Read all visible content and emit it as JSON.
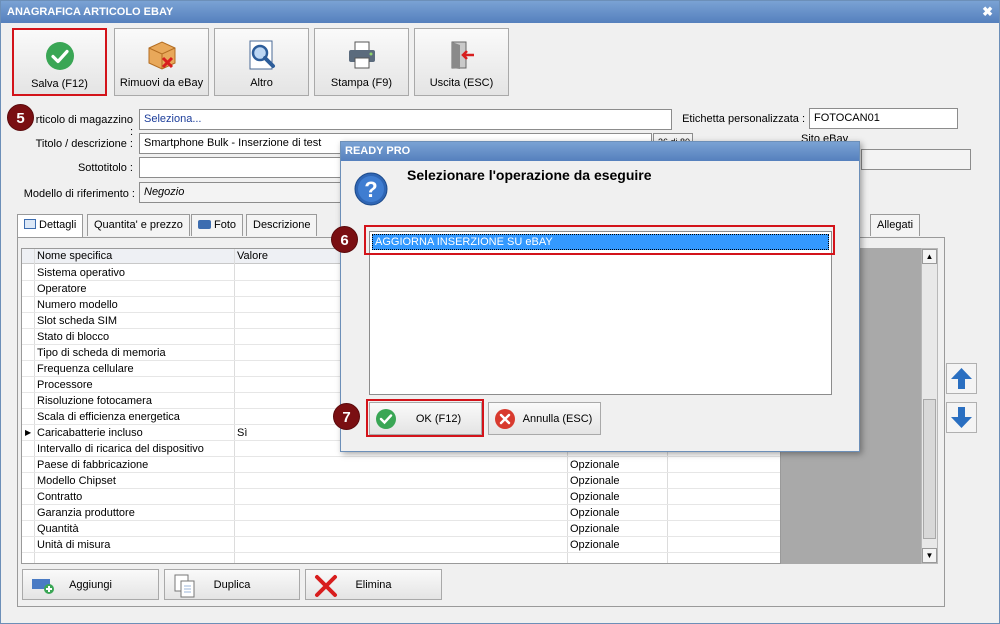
{
  "window": {
    "title": "ANAGRAFICA ARTICOLO EBAY",
    "close_glyph": "✖"
  },
  "toolbar": [
    {
      "label": "Salva (F12)",
      "icon": "check-circle-icon"
    },
    {
      "label": "Rimuovi da eBay",
      "icon": "box-remove-icon"
    },
    {
      "label": "Altro",
      "icon": "magnify-icon"
    },
    {
      "label": "Stampa (F9)",
      "icon": "printer-icon"
    },
    {
      "label": "Uscita (ESC)",
      "icon": "exit-door-icon"
    }
  ],
  "form": {
    "articolo_label": "rticolo di magazzino :",
    "articolo_value": "Seleziona...",
    "titolo_label": "Titolo / descrizione :",
    "titolo_value": "Smartphone Bulk - Inserzione di test",
    "titolo_counter": "36 di 80",
    "sottotitolo_label": "Sottotitolo :",
    "sottotitolo_value": "",
    "modello_label": "Modello di riferimento :",
    "modello_value": "Negozio",
    "etichetta_label": "Etichetta personalizzata :",
    "etichetta_value": "FOTOCAN01",
    "sito_label": "Sito eBay"
  },
  "badges": {
    "b5": "5",
    "b6": "6",
    "b7": "7"
  },
  "tabs": [
    "Dettagli",
    "Quantita' e prezzo",
    "Foto",
    "Descrizione",
    "Allegati"
  ],
  "grid": {
    "col_name": "Nome specifica",
    "col_value": "Valore",
    "rows": [
      {
        "name": "Sistema operativo",
        "value": "",
        "type": ""
      },
      {
        "name": "Operatore",
        "value": "",
        "type": ""
      },
      {
        "name": "Numero modello",
        "value": "",
        "type": ""
      },
      {
        "name": "Slot scheda SIM",
        "value": "",
        "type": ""
      },
      {
        "name": "Stato di blocco",
        "value": "",
        "type": ""
      },
      {
        "name": "Tipo di scheda di memoria",
        "value": "",
        "type": ""
      },
      {
        "name": "Frequenza cellulare",
        "value": "",
        "type": ""
      },
      {
        "name": "Processore",
        "value": "",
        "type": ""
      },
      {
        "name": "Risoluzione fotocamera",
        "value": "",
        "type": ""
      },
      {
        "name": "Scala di efficienza energetica",
        "value": "",
        "type": ""
      },
      {
        "name": "Caricabatterie incluso",
        "value": "Sì",
        "type": ""
      },
      {
        "name": "Intervallo di ricarica del dispositivo",
        "value": "",
        "type": ""
      },
      {
        "name": "Paese di fabbricazione",
        "value": "",
        "type": "Opzionale"
      },
      {
        "name": "Modello Chipset",
        "value": "",
        "type": "Opzionale"
      },
      {
        "name": "Contratto",
        "value": "",
        "type": "Opzionale"
      },
      {
        "name": "Garanzia produttore",
        "value": "",
        "type": "Opzionale"
      },
      {
        "name": "Quantità",
        "value": "",
        "type": "Opzionale"
      },
      {
        "name": "Unità di misura",
        "value": "",
        "type": "Opzionale"
      }
    ]
  },
  "bottom_buttons": [
    {
      "label": "Aggiungi",
      "icon": "add-icon"
    },
    {
      "label": "Duplica",
      "icon": "duplicate-icon"
    },
    {
      "label": "Elimina",
      "icon": "delete-x-icon"
    }
  ],
  "dialog": {
    "title": "READY PRO",
    "heading": "Selezionare l'operazione da eseguire",
    "options": [
      "AGGIORNA INSERZIONE SU eBAY"
    ],
    "ok_label": "OK (F12)",
    "cancel_label": "Annulla (ESC)"
  },
  "colors": {
    "highlight": "#d3131a",
    "badge": "#7a0f12",
    "selection": "#3399ff",
    "titlebar": "#5580bd"
  }
}
